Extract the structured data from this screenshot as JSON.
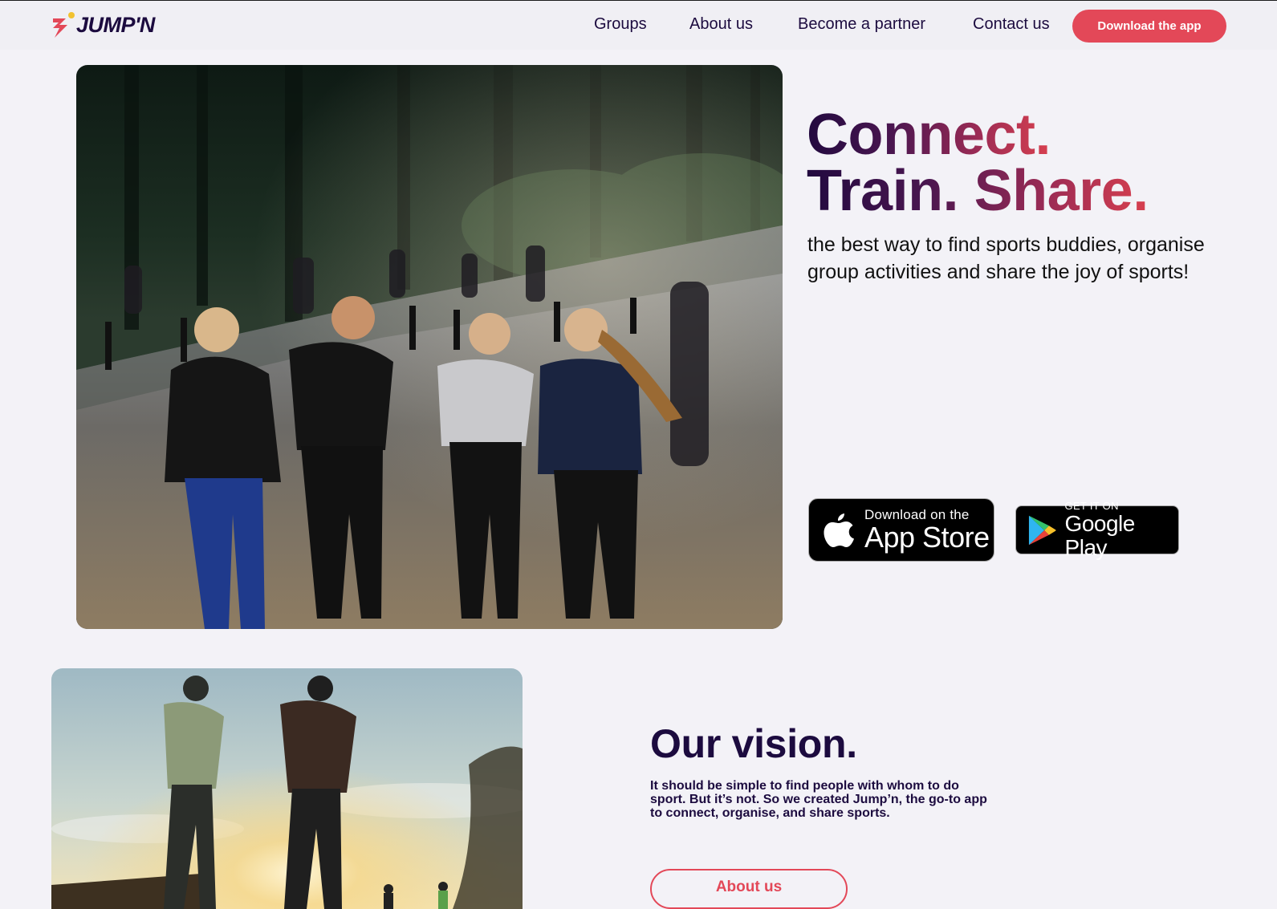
{
  "header": {
    "logo_text": "JUMP'N",
    "nav": [
      "Groups",
      "About us",
      "Become a partner",
      "Contact us"
    ],
    "cta_label": "Download the app"
  },
  "hero": {
    "headline_line1": "Connect.",
    "headline_line2a": "Train.",
    "headline_line2b": "Share.",
    "tagline": "the best way to find sports buddies, organise group activities and share the joy of sports!",
    "app_store": {
      "small": "Download on the",
      "big": "App Store"
    },
    "google_play": {
      "small": "GET IT ON",
      "big": "Google Play"
    }
  },
  "vision": {
    "title": "Our vision.",
    "text": "It should be simple to find people with whom to do sport. But it’s not. So we created Jump’n, the go-to app to connect, organise, and share sports.",
    "button_label": "About us"
  },
  "colors": {
    "brand_dark": "#1c0b3f",
    "brand_red": "#e34858",
    "background": "#f3f2f7"
  }
}
